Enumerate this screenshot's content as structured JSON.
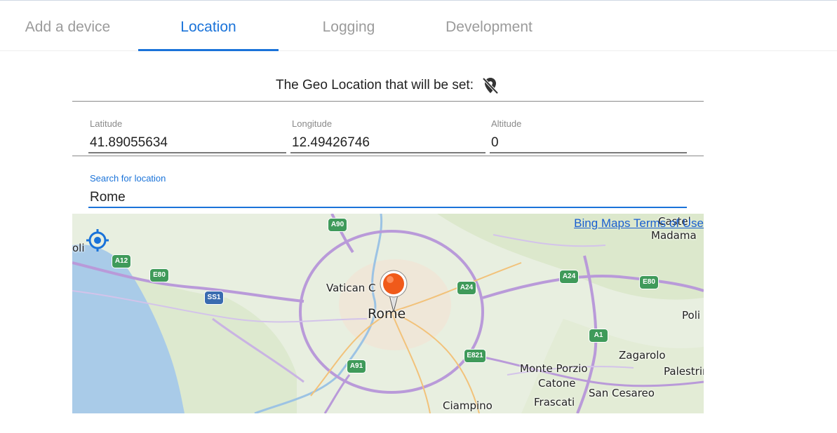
{
  "tabs": [
    {
      "label": "Add a device",
      "active": false
    },
    {
      "label": "Location",
      "active": true
    },
    {
      "label": "Logging",
      "active": false
    },
    {
      "label": "Development",
      "active": false
    }
  ],
  "geo": {
    "header": "The Geo Location that will be set:",
    "icon": "location-off-icon"
  },
  "coords": {
    "latitude_label": "Latitude",
    "latitude_value": "41.89055634",
    "longitude_label": "Longitude",
    "longitude_value": "12.49426746",
    "altitude_label": "Altitude",
    "altitude_value": "0"
  },
  "search": {
    "label": "Search for location",
    "value": "Rome"
  },
  "map": {
    "terms_link": "Bing Maps Terms of Use",
    "places": {
      "rome": "Rome",
      "vatican": "Vatican C",
      "castel": "Castel",
      "madama": "Madama",
      "oli": "oli",
      "poli": "Poli",
      "zagarolo": "Zagarolo",
      "monte_porzio": "Monte Porzio",
      "catone": "Catone",
      "palestrina": "Palestrir",
      "san_cesareo": "San Cesareo",
      "frascati": "Frascati",
      "ciampino": "Ciampino"
    },
    "shields": {
      "a90": "A90",
      "a12": "A12",
      "e80_west": "E80",
      "ss1": "SS1",
      "a24_center": "A24",
      "a24_east": "A24",
      "e80_east": "E80",
      "a1": "A1",
      "e821": "E821",
      "a91": "A91"
    },
    "colors": {
      "accent": "#1a73d9",
      "sea": "#a9cbe8",
      "land": "#e8efe0",
      "motorway": "#b99ad9",
      "pin": "#f05a1a"
    }
  }
}
